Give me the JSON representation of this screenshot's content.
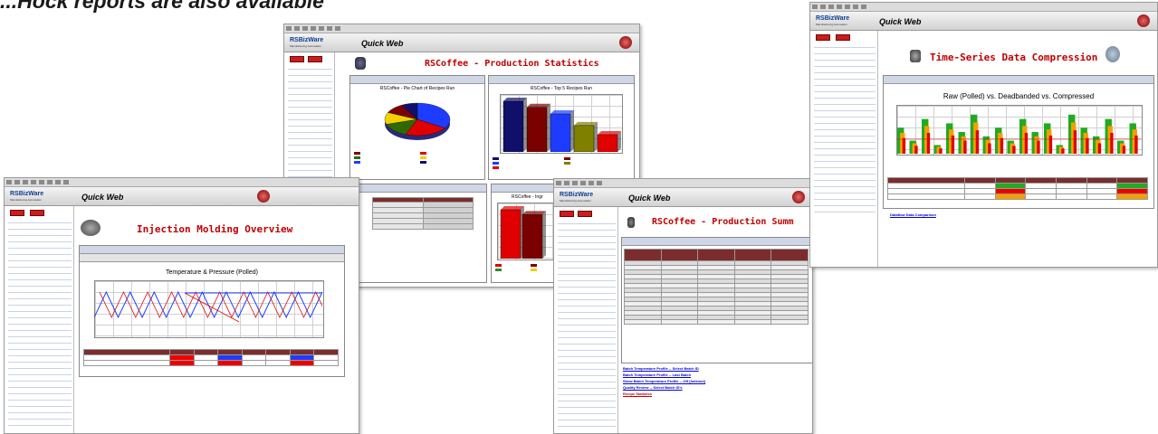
{
  "headline": "...Hock reports are also available",
  "app": {
    "logo_text": "RS",
    "logo_brand": "BizWare",
    "logo_sub": "Manufacturing Automation",
    "product": "Quick Web",
    "sidebar_buttons": [
      "",
      ""
    ]
  },
  "windows": {
    "production_stats": {
      "title": "RSCoffee - Production Statistics",
      "pie_title": "RSCoffee - Pie Chart of Recipes Run",
      "bar_title": "RSCoffee - Top 5 Recipes Run",
      "ingredients_title": "RSCoffee - Ingr"
    },
    "injection": {
      "title": "Injection Molding Overview",
      "chart_title": "Temperature & Pressure (Polled)"
    },
    "summary": {
      "title": "RSCoffee - Production Summ",
      "links": [
        "Batch Temperature Profile -- Select Batch ID",
        "Batch Temperature Profile -- Last Batch",
        "Show Batch Temperature Profile -- Off (Indexed)",
        "Quality Review -- Select Batch ID's",
        "Recipe Statistics"
      ]
    },
    "compression": {
      "title": "Time-Series Data Compression",
      "chart_title": "Raw (Polled) vs. Deadbanded vs. Compressed",
      "link": "Dataflow Data Comparison"
    }
  },
  "colors": {
    "title_red": "#c00000",
    "brand_blue": "#0a3d91",
    "series_red": "#e00000",
    "series_blue": "#1e3cff",
    "series_green": "#22aa22",
    "series_orange": "#f2a000"
  },
  "chart_data": [
    {
      "type": "pie",
      "title": "RSCoffee - Pie Chart of Recipes Run",
      "values": [
        34,
        22,
        14,
        12,
        10,
        8
      ]
    },
    {
      "type": "bar",
      "title": "RSCoffee - Top 5 Recipes Run",
      "values": [
        100,
        88,
        75,
        52,
        34
      ]
    },
    {
      "type": "bar",
      "title": "RSCoffee - Ingr",
      "values": [
        100,
        90
      ]
    },
    {
      "type": "line",
      "title": "Temperature & Pressure (Polled)",
      "series": [
        {
          "values": [
            6,
            14,
            6,
            14,
            6,
            14,
            6,
            14,
            6,
            14,
            6,
            14,
            6,
            14,
            6,
            14,
            6,
            14,
            6,
            14
          ]
        },
        {
          "values": [
            6,
            6,
            6,
            6,
            6,
            6,
            6,
            6,
            6,
            6,
            6,
            6,
            6,
            6,
            6,
            6,
            6,
            6,
            6,
            6
          ]
        }
      ]
    },
    {
      "type": "bar",
      "title": "Raw (Polled) vs. Deadbanded vs. Compressed",
      "values": [
        6,
        3,
        8,
        2,
        7,
        5,
        9,
        4,
        6,
        3,
        8,
        5,
        7,
        2,
        9,
        6,
        4,
        8,
        3,
        7
      ]
    }
  ]
}
